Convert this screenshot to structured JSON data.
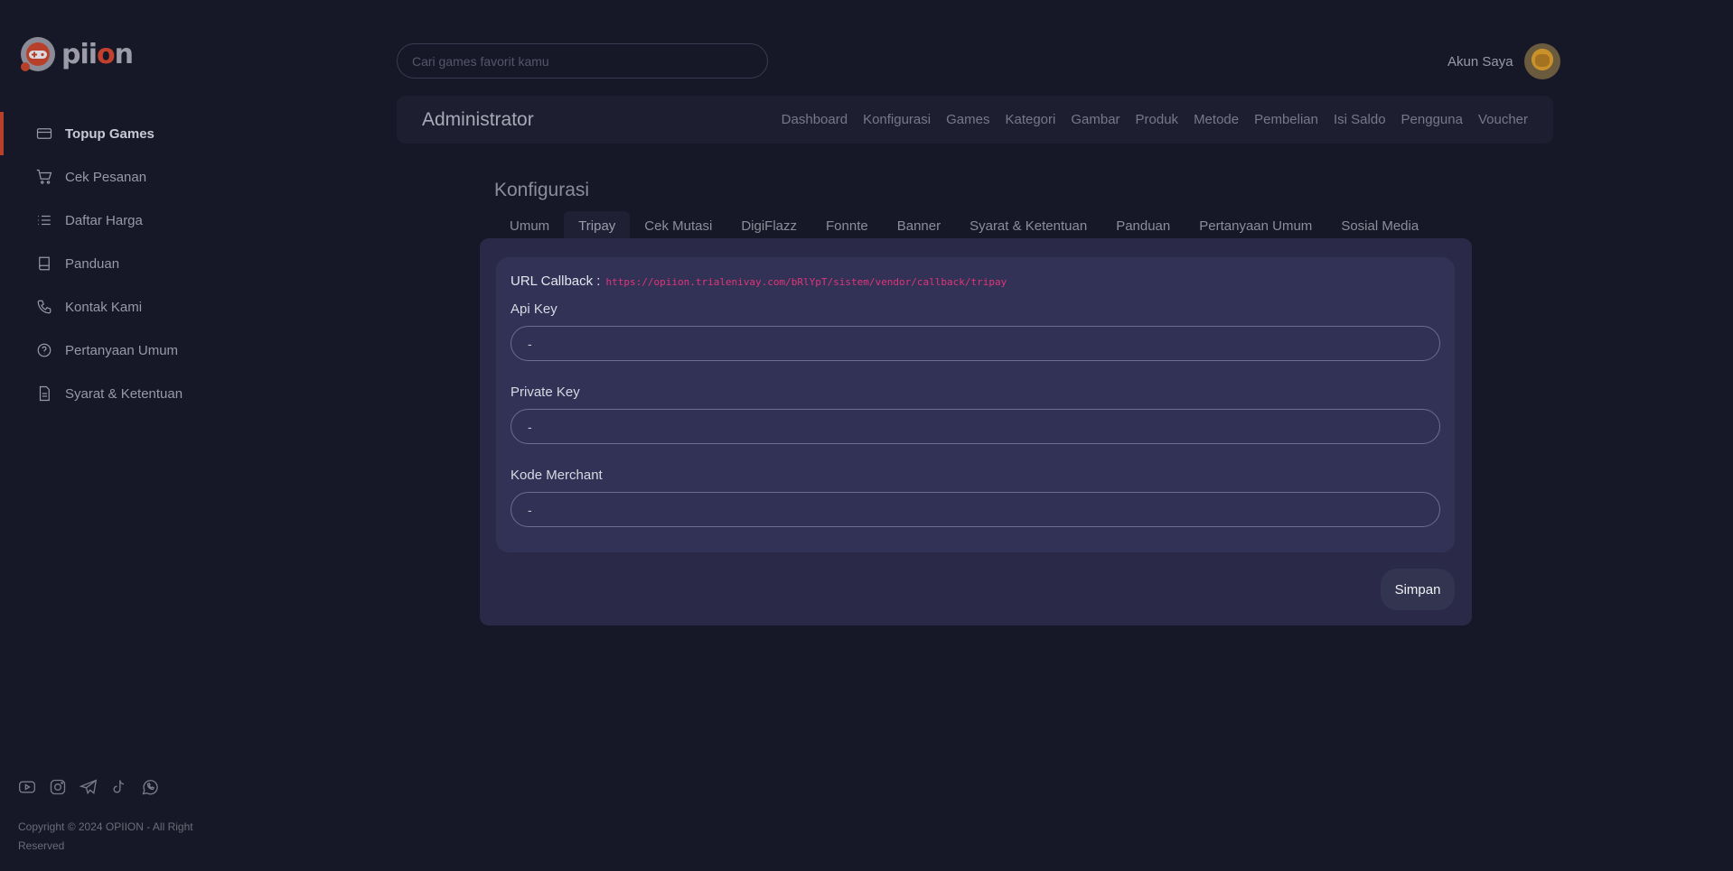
{
  "brand": {
    "name_prefix": "pii",
    "name_accent": "o",
    "name_suffix": "n"
  },
  "sidebar": {
    "items": [
      {
        "label": "Topup Games",
        "icon": "credit-card-icon",
        "active": true
      },
      {
        "label": "Cek Pesanan",
        "icon": "cart-icon"
      },
      {
        "label": "Daftar Harga",
        "icon": "list-icon"
      },
      {
        "label": "Panduan",
        "icon": "book-icon"
      },
      {
        "label": "Kontak Kami",
        "icon": "phone-icon"
      },
      {
        "label": "Pertanyaan Umum",
        "icon": "help-circle-icon"
      },
      {
        "label": "Syarat & Ketentuan",
        "icon": "document-icon"
      }
    ],
    "social": [
      "youtube-icon",
      "instagram-icon",
      "telegram-icon",
      "tiktok-icon",
      "whatsapp-icon"
    ],
    "copyright": "Copyright © 2024 OPIION - All Right Reserved"
  },
  "search": {
    "placeholder": "Cari games favorit kamu"
  },
  "account": {
    "label": "Akun Saya"
  },
  "admin": {
    "title": "Administrator",
    "menu": [
      "Dashboard",
      "Konfigurasi",
      "Games",
      "Kategori",
      "Gambar",
      "Produk",
      "Metode",
      "Pembelian",
      "Isi Saldo",
      "Pengguna",
      "Voucher"
    ]
  },
  "page": {
    "title": "Konfigurasi",
    "tabs": [
      "Umum",
      "Tripay",
      "Cek Mutasi",
      "DigiFlazz",
      "Fonnte",
      "Banner",
      "Syarat & Ketentuan",
      "Panduan",
      "Pertanyaan Umum",
      "Sosial Media"
    ],
    "active_tab": 1
  },
  "form": {
    "callback_label": "URL Callback :",
    "callback_url": "https://opiion.trialenivay.com/bRlYpT/sistem/vendor/callback/tripay",
    "api_key_label": "Api Key",
    "api_key_value": "-",
    "private_key_label": "Private Key",
    "private_key_value": "-",
    "merchant_label": "Kode Merchant",
    "merchant_value": "-",
    "save_label": "Simpan"
  },
  "colors": {
    "accent": "#b8402b",
    "callback_url": "#e0357a",
    "panel": "#2a2a48",
    "background": "#171827"
  }
}
